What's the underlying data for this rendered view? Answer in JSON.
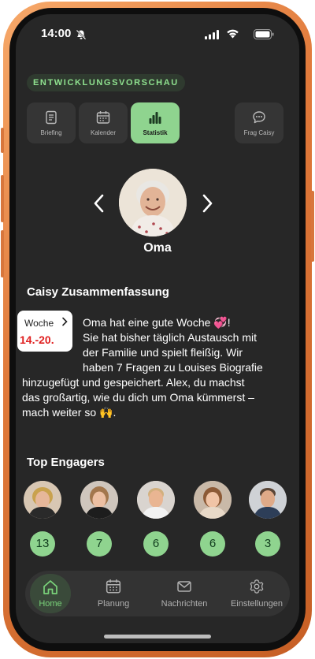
{
  "status_bar": {
    "time": "14:00",
    "icons": [
      "bell-slash-icon",
      "signal-icon",
      "wifi-icon",
      "battery-icon"
    ]
  },
  "badge": "ENTWICKLUNGSVORSCHAU",
  "tabs": [
    {
      "label": "Briefing",
      "icon": "document-icon",
      "active": false
    },
    {
      "label": "Kalender",
      "icon": "calendar-icon",
      "active": false
    },
    {
      "label": "Statistik",
      "icon": "bar-chart-icon",
      "active": true
    },
    {
      "label": "Frag Caisy",
      "icon": "chat-icon",
      "active": false
    }
  ],
  "profile": {
    "name": "Oma"
  },
  "summary": {
    "title": "Caisy Zusammenfassung",
    "week_label": "Woche",
    "week_range": "14.-20.",
    "line1": "Oma hat eine gute Woche 💞!",
    "line2": "Sie hat bisher täglich Austausch mit",
    "line3": "der Familie und spielt fleißig. Wir",
    "line4": "haben 7 Fragen zu Louises Biografie",
    "line5": "hinzugefügt und gespeichert. Alex, du machst",
    "line6": "das großartig, wie du dich um Oma kümmerst –",
    "line7": "mach weiter so 🙌."
  },
  "engagers": {
    "title": "Top Engagers",
    "counts": [
      "13",
      "7",
      "6",
      "6",
      "3"
    ]
  },
  "bottom_nav": [
    {
      "label": "Home",
      "icon": "home-icon",
      "active": true
    },
    {
      "label": "Planung",
      "icon": "calendar-icon",
      "active": false
    },
    {
      "label": "Nachrichten",
      "icon": "mail-icon",
      "active": false
    },
    {
      "label": "Einstellungen",
      "icon": "gear-icon",
      "active": false
    }
  ],
  "colors": {
    "accent": "#8fd48f",
    "accent_text": "#7ad37a",
    "screen_bg": "#272727",
    "week_red": "#e02020",
    "frame_orange": "#e0793a"
  }
}
